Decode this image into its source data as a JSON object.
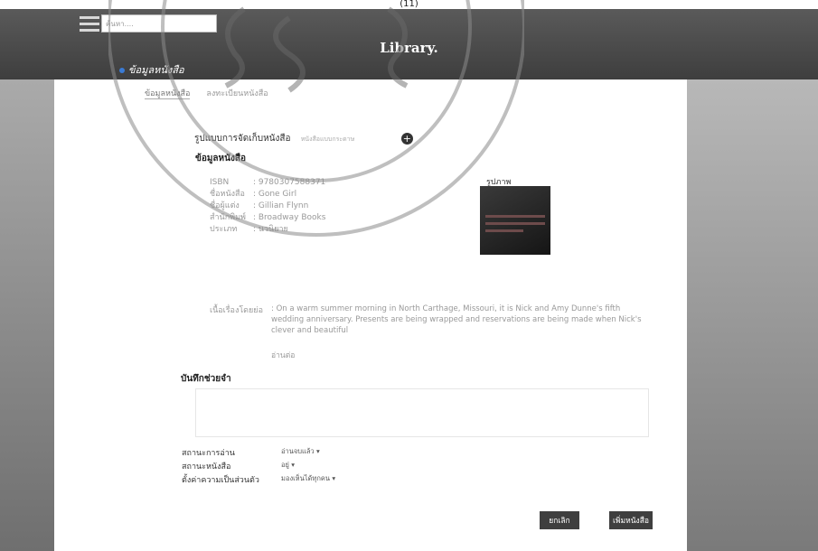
{
  "page_number": "(11)",
  "header": {
    "brand": "Library.",
    "search_placeholder": "ค้นหา...."
  },
  "breadcrumb": "ข้อมูลหนังสือ",
  "tabs": [
    "ข้อมูลหนังสือ",
    "ลงทะเบียนหนังสือ"
  ],
  "format": {
    "label": "รูปแบบการจัดเก็บหนังสือ",
    "value": "หนังสือแบบกระดาษ"
  },
  "book": {
    "section_title": "ข้อมูลหนังสือ",
    "fields": [
      {
        "label": "ISBN",
        "value": ": 9780307588371"
      },
      {
        "label": "ชื่อหนังสือ",
        "value": ": Gone Girl"
      },
      {
        "label": "ชื่อผู้แต่ง",
        "value": ": Gillian Flynn"
      },
      {
        "label": "สำนักพิมพ์",
        "value": ": Broadway Books"
      },
      {
        "label": "ประเภท",
        "value": ": นวนิยาย"
      }
    ],
    "cover_label": "รูปภาพ",
    "synopsis_label": "เนื้อเรื่องโดยย่อ",
    "synopsis": ": On a warm summer morning in North Carthage, Missouri, it is Nick and Amy Dunne's fifth wedding anniversary. Presents are being wrapped and reservations are being made when Nick's clever and beautiful",
    "more": "อ่านต่อ"
  },
  "note_label": "บันทึกช่วยจำ",
  "status": [
    {
      "label": "สถานะการอ่าน",
      "value": "อ่านจบแล้ว ▾"
    },
    {
      "label": "สถานะหนังสือ",
      "value": "อยู่ ▾"
    },
    {
      "label": "ตั้งค่าความเป็นส่วนตัว",
      "value": "มองเห็นได้ทุกคน ▾"
    }
  ],
  "buttons": {
    "cancel": "ยกเลิก",
    "add": "เพิ่มหนังสือ"
  },
  "watermark_text": "มหาวิทยาลัยเทคโนโลยีพระจอมเกล้าเจ้าคุณทหารลาดกระบัง"
}
